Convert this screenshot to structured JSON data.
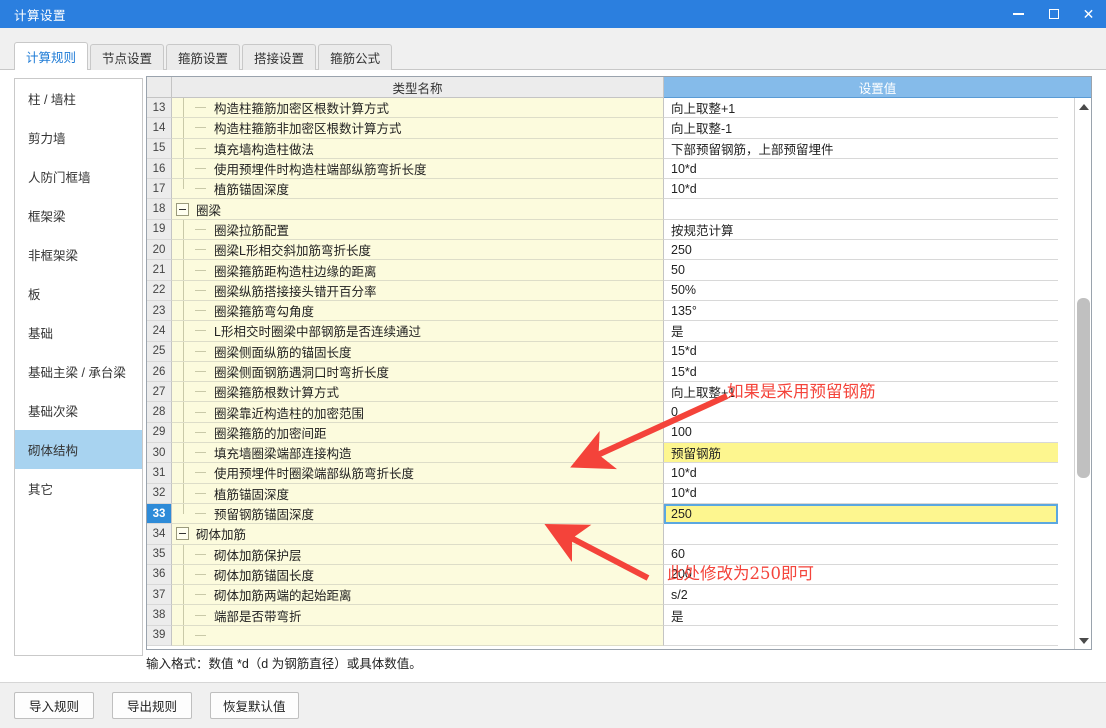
{
  "window": {
    "title": "计算设置",
    "controls": {
      "minimize": "minimize-icon",
      "maximize": "maximize-icon",
      "close": "close-icon"
    },
    "accent_color": "#2b7fdf"
  },
  "tabs": [
    {
      "label": "计算规则",
      "active": true
    },
    {
      "label": "节点设置",
      "active": false
    },
    {
      "label": "箍筋设置",
      "active": false
    },
    {
      "label": "搭接设置",
      "active": false
    },
    {
      "label": "箍筋公式",
      "active": false
    }
  ],
  "sidebar": {
    "items": [
      {
        "label": "柱 / 墙柱",
        "active": false
      },
      {
        "label": "剪力墙",
        "active": false
      },
      {
        "label": "人防门框墙",
        "active": false
      },
      {
        "label": "框架梁",
        "active": false
      },
      {
        "label": "非框架梁",
        "active": false
      },
      {
        "label": "板",
        "active": false
      },
      {
        "label": "基础",
        "active": false
      },
      {
        "label": "基础主梁 / 承台梁",
        "active": false
      },
      {
        "label": "基础次梁",
        "active": false
      },
      {
        "label": "砌体结构",
        "active": true
      },
      {
        "label": "其它",
        "active": false
      }
    ]
  },
  "grid": {
    "columns": {
      "index": "",
      "name": "类型名称",
      "value": "设置值"
    },
    "value_column_selected": true,
    "rows": [
      {
        "n": "13",
        "kind": "leaf",
        "name": "构造柱箍筋加密区根数计算方式",
        "value": "向上取整+1",
        "value_state": "normal"
      },
      {
        "n": "14",
        "kind": "leaf",
        "name": "构造柱箍筋非加密区根数计算方式",
        "value": "向上取整-1",
        "value_state": "normal"
      },
      {
        "n": "15",
        "kind": "leaf",
        "name": "填充墙构造柱做法",
        "value": "下部预留钢筋，上部预留埋件",
        "value_state": "normal"
      },
      {
        "n": "16",
        "kind": "leaf",
        "name": "使用预埋件时构造柱端部纵筋弯折长度",
        "value": "10*d",
        "value_state": "normal"
      },
      {
        "n": "17",
        "kind": "last",
        "name": "植筋锚固深度",
        "value": "10*d",
        "value_state": "normal"
      },
      {
        "n": "18",
        "kind": "group",
        "name": "圈梁",
        "value": "",
        "value_state": "empty"
      },
      {
        "n": "19",
        "kind": "leaf",
        "name": "圈梁拉筋配置",
        "value": "按规范计算",
        "value_state": "normal"
      },
      {
        "n": "20",
        "kind": "leaf",
        "name": "圈梁L形相交斜加筋弯折长度",
        "value": "250",
        "value_state": "normal"
      },
      {
        "n": "21",
        "kind": "leaf",
        "name": "圈梁箍筋距构造柱边缘的距离",
        "value": "50",
        "value_state": "normal"
      },
      {
        "n": "22",
        "kind": "leaf",
        "name": "圈梁纵筋搭接接头错开百分率",
        "value": "50%",
        "value_state": "normal"
      },
      {
        "n": "23",
        "kind": "leaf",
        "name": "圈梁箍筋弯勾角度",
        "value": "135°",
        "value_state": "normal"
      },
      {
        "n": "24",
        "kind": "leaf",
        "name": "L形相交时圈梁中部钢筋是否连续通过",
        "value": "是",
        "value_state": "normal"
      },
      {
        "n": "25",
        "kind": "leaf",
        "name": "圈梁侧面纵筋的锚固长度",
        "value": "15*d",
        "value_state": "normal"
      },
      {
        "n": "26",
        "kind": "leaf",
        "name": "圈梁侧面钢筋遇洞口时弯折长度",
        "value": "15*d",
        "value_state": "normal"
      },
      {
        "n": "27",
        "kind": "leaf",
        "name": "圈梁箍筋根数计算方式",
        "value": "向上取整+1",
        "value_state": "normal"
      },
      {
        "n": "28",
        "kind": "leaf",
        "name": "圈梁靠近构造柱的加密范围",
        "value": "0",
        "value_state": "normal"
      },
      {
        "n": "29",
        "kind": "leaf",
        "name": "圈梁箍筋的加密间距",
        "value": "100",
        "value_state": "normal"
      },
      {
        "n": "30",
        "kind": "leaf",
        "name": "填充墙圈梁端部连接构造",
        "value": "预留钢筋",
        "value_state": "highlight"
      },
      {
        "n": "31",
        "kind": "leaf",
        "name": "使用预埋件时圈梁端部纵筋弯折长度",
        "value": "10*d",
        "value_state": "normal"
      },
      {
        "n": "32",
        "kind": "leaf",
        "name": "植筋锚固深度",
        "value": "10*d",
        "value_state": "normal"
      },
      {
        "n": "33",
        "kind": "last",
        "name": "预留钢筋锚固深度",
        "value": "250",
        "value_state": "editing",
        "selected": true
      },
      {
        "n": "34",
        "kind": "group",
        "name": "砌体加筋",
        "value": "",
        "value_state": "empty"
      },
      {
        "n": "35",
        "kind": "leaf",
        "name": "砌体加筋保护层",
        "value": "60",
        "value_state": "normal"
      },
      {
        "n": "36",
        "kind": "leaf",
        "name": "砌体加筋锚固长度",
        "value": "200",
        "value_state": "normal"
      },
      {
        "n": "37",
        "kind": "leaf",
        "name": "砌体加筋两端的起始距离",
        "value": "s/2",
        "value_state": "normal"
      },
      {
        "n": "38",
        "kind": "leaf",
        "name": "端部是否带弯折",
        "value": "是",
        "value_state": "normal"
      },
      {
        "n": "39",
        "kind": "leaf",
        "name": "",
        "value": "",
        "value_state": "normal"
      }
    ],
    "scrollbar": {
      "up": "scroll-up-arrow",
      "down": "scroll-down-arrow"
    }
  },
  "hint": "输入格式：数值 *d（d 为钢筋直径）或具体数值。",
  "footer": {
    "buttons": [
      {
        "label": "导入规则"
      },
      {
        "label": "导出规则"
      },
      {
        "label": "恢复默认值"
      }
    ]
  },
  "annotations": [
    {
      "id": "anno1",
      "text": "如果是采用预留钢筋",
      "color": "#f4443b"
    },
    {
      "id": "anno2",
      "text": "此处修改为250即可",
      "color": "#f4443b"
    }
  ]
}
